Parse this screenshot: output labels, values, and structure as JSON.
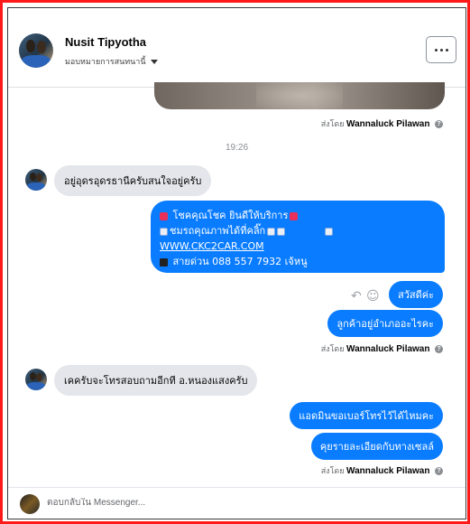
{
  "header": {
    "name": "Nusit Tipyotha",
    "assign_label": "มอบหมายการสนทนานี้",
    "more_icon": "more-horizontal-icon"
  },
  "sent_by": {
    "prefix": "ส่งโดย",
    "agent": "Wannaluck Pilawan"
  },
  "timestamp": "19:26",
  "messages": {
    "in1": "อยู่อุดรอุดรธานีครับสนใจอยู่ครับ",
    "promo_line1": "โชคคุณโชค ยินดีให้บริการ",
    "promo_line2": "ชมรถคุณภาพได้ที่คลิ๊ก",
    "promo_link": "WWW.CKC2CAR.COM",
    "promo_line4": "สายด่วน 088 557 7932 เจ้หนู",
    "out2": "สวัสดีค่ะ",
    "out3": "ลูกค้าอยู่อำเภออะไรคะ",
    "in2": "เคครับจะโทรสอบถามอีกที อ.หนองแสงครับ",
    "out4": "แอดมินขอเบอร์โทรไว้ได้ไหมคะ",
    "out5": "คุยรายละเอียดกับทางเซลล์"
  },
  "composer": {
    "placeholder": "ตอบกลับใน Messenger..."
  },
  "colors": {
    "frame": "#ff1a1a",
    "outgoing": "#0a7cff",
    "incoming": "#e4e6eb"
  }
}
